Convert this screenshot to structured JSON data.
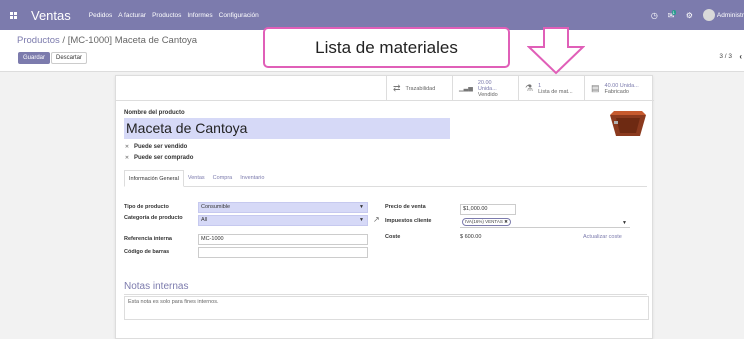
{
  "navbar": {
    "app_name": "Ventas",
    "menu": [
      "Pedidos",
      "A facturar",
      "Productos",
      "Informes",
      "Configuración"
    ],
    "messages_badge": "1",
    "user_name": "Administr"
  },
  "breadcrumb": {
    "parent": "Productos",
    "separator": " / ",
    "current": "[MC-1000] Maceta de Cantoya"
  },
  "buttons": {
    "save": "Guardar",
    "discard": "Descartar"
  },
  "pager": "3 / 3",
  "annotation": "Lista de materiales",
  "smart_buttons": [
    {
      "icon": "arrows-icon",
      "glyph": "⇄",
      "line1": "Trazabilidad",
      "line2": ""
    },
    {
      "icon": "bar-chart-icon",
      "glyph": "▁▃▅",
      "line1": "20.00 Unida...",
      "line2": "Vendido"
    },
    {
      "icon": "flask-icon",
      "glyph": "⚗",
      "line1": "1",
      "line2": "Lista de mat..."
    },
    {
      "icon": "factory-icon",
      "glyph": "▤",
      "line1": "40.00 Unida...",
      "line2": "Fabricado"
    }
  ],
  "product": {
    "name_label": "Nombre del producto",
    "name": "Maceta de Cantoya",
    "can_be_sold": "Puede ser vendido",
    "can_be_purchased": "Puede ser comprado"
  },
  "tabs": [
    "Información General",
    "Ventas",
    "Compra",
    "Inventario"
  ],
  "general": {
    "type_label": "Tipo de producto",
    "type_value": "Consumible",
    "category_label": "Categoría de producto",
    "category_value": "All",
    "ref_label": "Referencia interna",
    "ref_value": "MC-1000",
    "barcode_label": "Código de barras",
    "barcode_value": "",
    "price_label": "Precio de venta",
    "price_value": "$1,000.00",
    "tax_label": "Impuestos cliente",
    "tax_tag": "IVA(16%) VENTAS",
    "cost_label": "Coste",
    "cost_value": "$ 600.00",
    "update_cost": "Actualizar coste"
  },
  "notes": {
    "title": "Notas internas",
    "text": "Esta nota es solo para fines internos."
  },
  "colors": {
    "brand": "#7c7bad",
    "highlight": "#d6d9f7",
    "annotation": "#e05fb8"
  }
}
